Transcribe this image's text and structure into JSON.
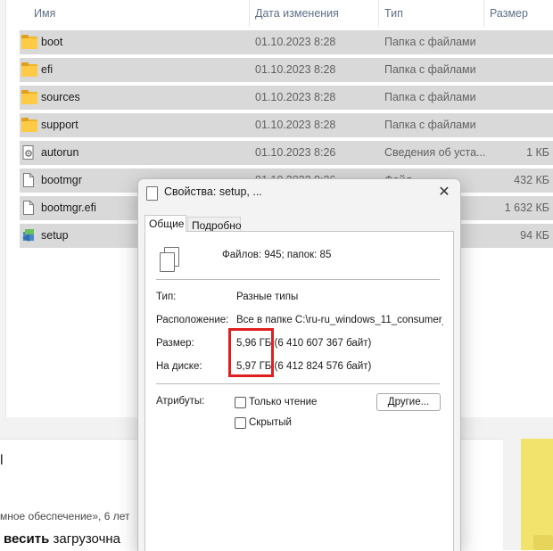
{
  "explorer": {
    "columns": [
      "Имя",
      "Дата изменения",
      "Тип",
      "Размер"
    ],
    "sort_glyph": "^",
    "rows": [
      {
        "name": "boot",
        "date": "01.10.2023 8:28",
        "type": "Папка с файлами",
        "size": "",
        "icon": "folder-icon"
      },
      {
        "name": "efi",
        "date": "01.10.2023 8:28",
        "type": "Папка с файлами",
        "size": "",
        "icon": "folder-icon"
      },
      {
        "name": "sources",
        "date": "01.10.2023 8:28",
        "type": "Папка с файлами",
        "size": "",
        "icon": "folder-icon"
      },
      {
        "name": "support",
        "date": "01.10.2023 8:28",
        "type": "Папка с файлами",
        "size": "",
        "icon": "folder-icon"
      },
      {
        "name": "autorun",
        "date": "01.10.2023 8:26",
        "type": "Сведения об уста...",
        "size": "1 КБ",
        "icon": "settings-file-icon"
      },
      {
        "name": "bootmgr",
        "date": "01.10.2023 8:26",
        "type": "Файл",
        "size": "432 КБ",
        "icon": "file-icon"
      },
      {
        "name": "bootmgr.efi",
        "date": "",
        "type": "",
        "size": "1 632 КБ",
        "icon": "file-icon"
      },
      {
        "name": "setup",
        "date": "",
        "type": "",
        "size": "94 КБ",
        "icon": "setup-icon"
      }
    ]
  },
  "web": {
    "fragment_char": "l",
    "subtext": "мное обеспечение», 6 лет",
    "line_bold": "весить",
    "line_rest": " загрузочна"
  },
  "dialog": {
    "title": "Свойства: setup, ...",
    "close_glyph": "✕",
    "tabs": [
      "Общие",
      "Подробно"
    ],
    "summary": "Файлов: 945; папок: 85",
    "fields": {
      "type_label": "Тип:",
      "type_value": "Разные типы",
      "location_label": "Расположение:",
      "location_value": "Все в папке C:\\ru-ru_windows_11_consumer_editions",
      "size_label": "Размер:",
      "size_value": "5,96 ГБ (6 410 607 367 байт)",
      "disk_label": "На диске:",
      "disk_value": "5,97 ГБ (6 412 824 576 байт)"
    },
    "attributes_label": "Атрибуты:",
    "readonly_label": "Только чтение",
    "hidden_label": "Скрытый",
    "other_button": "Другие...",
    "colors": {
      "highlight": "#e02020"
    }
  }
}
